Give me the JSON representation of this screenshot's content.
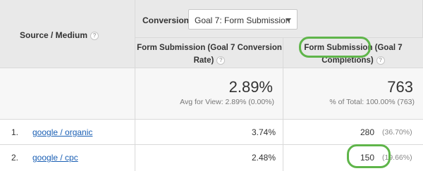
{
  "header": {
    "source_medium": "Source / Medium",
    "conversions_label": "Conversions",
    "goal_select_value": "Goal 7: Form Submission",
    "col_rate": {
      "line1": "Form Submission (Goal 7 Conversion",
      "line2": "Rate)"
    },
    "col_completions": {
      "line1": "Form Submission (Goal 7",
      "line2": "Completions)"
    },
    "help_glyph": "?"
  },
  "summary": {
    "rate_value": "2.89%",
    "rate_sub": "Avg for View: 2.89% (0.00%)",
    "completions_value": "763",
    "completions_sub": "% of Total: 100.00% (763)"
  },
  "rows": [
    {
      "index": "1.",
      "source": "google / organic",
      "rate": "3.74%",
      "completions": "280",
      "completions_pct": "(36.70%)"
    },
    {
      "index": "2.",
      "source": "google / cpc",
      "rate": "2.48%",
      "completions": "150",
      "completions_pct": "(19.66%)"
    }
  ],
  "colors": {
    "highlight_ring": "#5fb54a",
    "link": "#1a5fb4",
    "header_bg": "#e9e9e9"
  }
}
